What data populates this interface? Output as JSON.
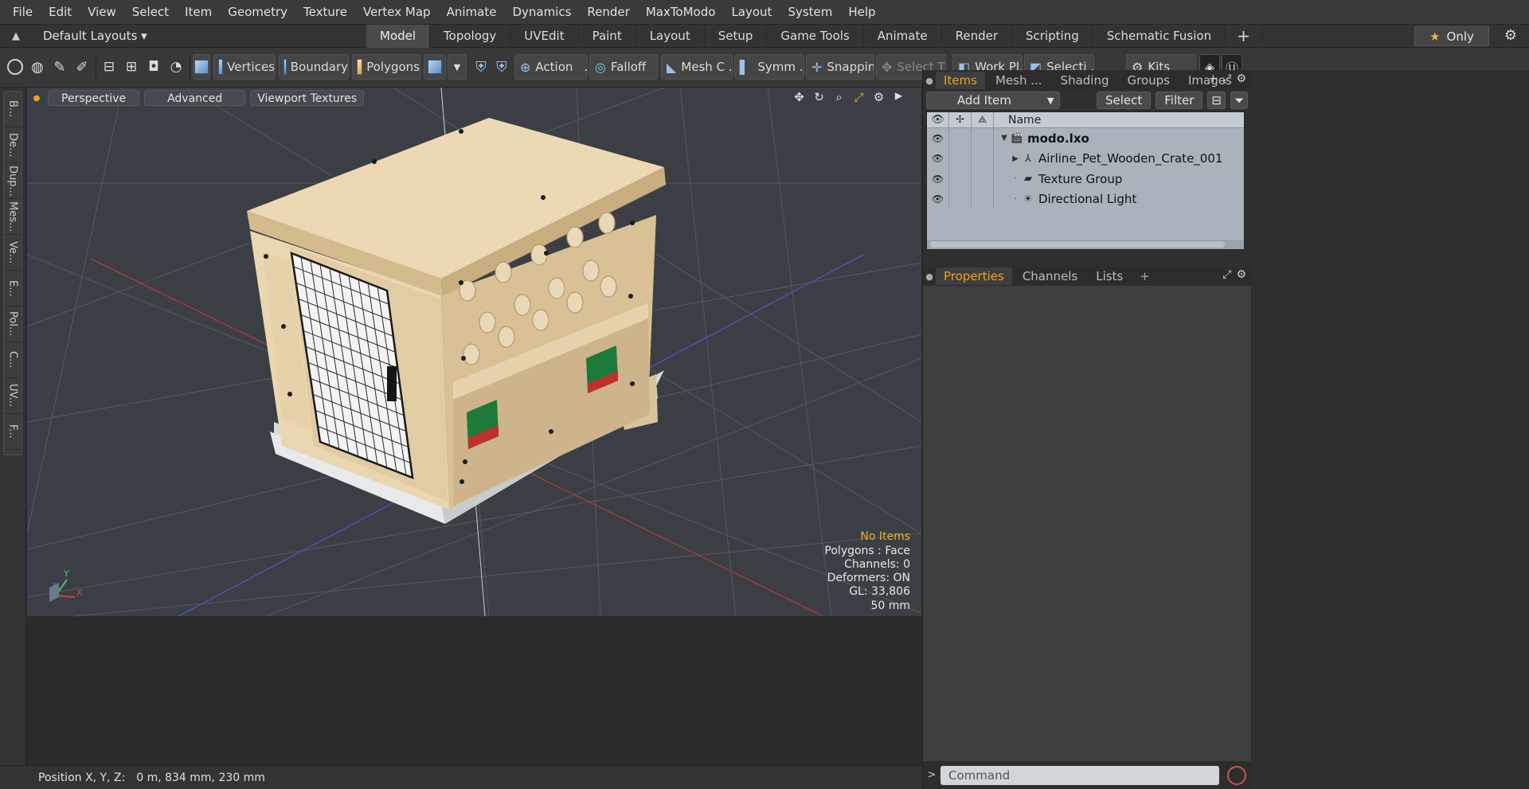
{
  "menu": [
    "File",
    "Edit",
    "View",
    "Select",
    "Item",
    "Geometry",
    "Texture",
    "Vertex Map",
    "Animate",
    "Dynamics",
    "Render",
    "MaxToModo",
    "Layout",
    "System",
    "Help"
  ],
  "layout_bar": {
    "default_layouts": "Default Layouts ▾",
    "tabs": [
      "Model",
      "Topology",
      "UVEdit",
      "Paint",
      "Layout",
      "Setup",
      "Game Tools",
      "Animate",
      "Render",
      "Scripting",
      "Schematic Fusion"
    ],
    "active_tab": "Model",
    "only_label": "Only"
  },
  "toolbar": {
    "vertices": "Vertices",
    "boundary": "Boundary",
    "polygons": "Polygons",
    "action": "Action",
    "falloff": "Falloff",
    "mesh": "Mesh C ...",
    "symmetry": "Symm ...",
    "snapping": "Snapping",
    "select_t": "Select T...",
    "work_plane": "Work Pl...",
    "selection": "Selecti ...",
    "kits": "Kits"
  },
  "left_tabs": [
    "B...",
    "De...",
    "Dup...",
    "Mes...",
    "Ve...",
    "E...",
    "Pol...",
    "C...",
    "UV...",
    "F..."
  ],
  "viewport": {
    "buttons": [
      "Perspective",
      "Advanced",
      "Viewport Textures"
    ],
    "info": {
      "no_items": "No Items",
      "polygons": "Polygons : Face",
      "channels": "Channels: 0",
      "deformers": "Deformers: ON",
      "gl": "GL: 33,806",
      "scale": "50 mm"
    },
    "axis_labels": {
      "y": "Y",
      "x": "X"
    }
  },
  "items_panel": {
    "tabs": [
      "Items",
      "Mesh ...",
      "Shading",
      "Groups",
      "Images"
    ],
    "active_tab": "Items",
    "add_item": "Add Item",
    "select": "Select",
    "filter": "Filter",
    "name_header": "Name",
    "rows": [
      {
        "name": "modo.lxo",
        "icon": "scene-icon",
        "bold": true,
        "tri": "▼"
      },
      {
        "name": "Airline_Pet_Wooden_Crate_001",
        "icon": "mesh-icon",
        "bold": false,
        "tri": "▶"
      },
      {
        "name": "Texture Group",
        "icon": "texture-group-icon",
        "bold": false,
        "tri": ""
      },
      {
        "name": "Directional Light",
        "icon": "light-icon",
        "bold": false,
        "tri": ""
      }
    ]
  },
  "properties_panel": {
    "tabs": [
      "Properties",
      "Channels",
      "Lists"
    ],
    "active_tab": "Properties"
  },
  "command_placeholder": "Command",
  "status": {
    "label": "Position X, Y, Z:",
    "value": "0 m, 834 mm, 230 mm"
  },
  "colors": {
    "accent_orange": "#f0a020",
    "viewport_bg": "#3b3f45",
    "crate_wood": "#e9d3ad"
  }
}
